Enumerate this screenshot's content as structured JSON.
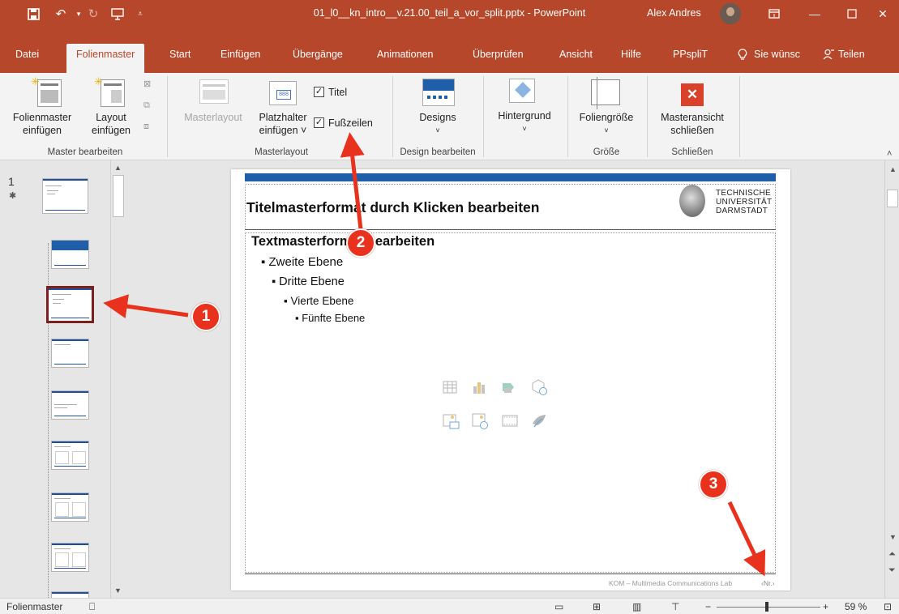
{
  "window": {
    "title": "01_l0__kn_intro__v.21.00_teil_a_vor_split.pptx  -  PowerPoint",
    "user": "Alex Andres",
    "accent": "#b7472a"
  },
  "tabs": [
    {
      "label": "Datei"
    },
    {
      "label": "Folienmaster"
    },
    {
      "label": "Start"
    },
    {
      "label": "Einfügen"
    },
    {
      "label": "Übergänge"
    },
    {
      "label": "Animationen"
    },
    {
      "label": "Überprüfen"
    },
    {
      "label": "Ansicht"
    },
    {
      "label": "Hilfe"
    },
    {
      "label": "PPspliT"
    },
    {
      "label": "Sie wünsc"
    },
    {
      "label": "Teilen"
    }
  ],
  "ribbon": {
    "folienmaster_einfuegen": {
      "line1": "Folienmaster",
      "line2": "einfügen"
    },
    "layout_einfuegen": {
      "line1": "Layout",
      "line2": "einfügen"
    },
    "master_bearbeiten": "Master bearbeiten",
    "masterlayout_btn": "Masterlayout",
    "platzhalter": {
      "line1": "Platzhalter",
      "line2": "einfügen ˅"
    },
    "titel": "Titel",
    "fusszeilen": "Fußzeilen",
    "masterlayout_group": "Masterlayout",
    "designs": "Designs",
    "design_bearbeiten": "Design bearbeiten",
    "hintergrund": "Hintergrund",
    "foliengroesse": "Foliengröße",
    "groesse": "Größe",
    "masteransicht": {
      "line1": "Masteransicht",
      "line2": "schließen"
    },
    "schliessen": "Schließen"
  },
  "thumbnails": {
    "number": "1"
  },
  "slide": {
    "title": "Titelmasterformat durch Klicken bearbeiten",
    "logo_lines": [
      "TECHNISCHE",
      "UNIVERSITÄT",
      "DARMSTADT"
    ],
    "bullets": [
      {
        "text": "Textmasterformat bearbeiten",
        "level": 1
      },
      {
        "text": "Zweite Ebene",
        "level": 2
      },
      {
        "text": "Dritte Ebene",
        "level": 3
      },
      {
        "text": "Vierte Ebene",
        "level": 4
      },
      {
        "text": "Fünfte Ebene",
        "level": 5
      }
    ],
    "footer": "KOM – Multimedia Communications Lab",
    "page_number": "‹Nr.›"
  },
  "statusbar": {
    "mode": "Folienmaster",
    "zoom": "59 %"
  },
  "annotations": {
    "m1": "1",
    "m2": "2",
    "m3": "3",
    "color": "#e8321e"
  }
}
